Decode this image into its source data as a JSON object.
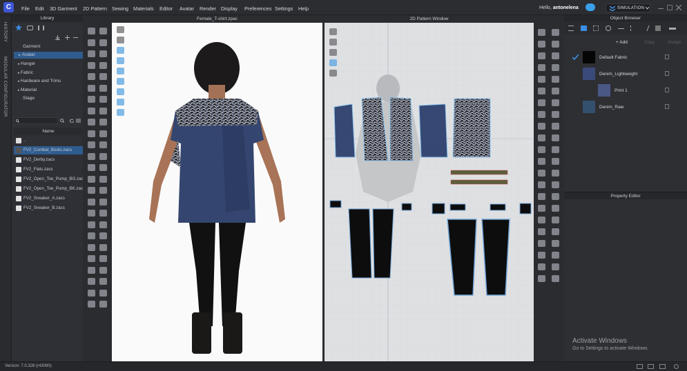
{
  "menu": [
    "File",
    "Edit",
    "3D Garment",
    "2D Pattern",
    "Sewing",
    "Materials",
    "Editor",
    "Avatar",
    "Render",
    "Display",
    "Preferences",
    "Settings",
    "Help"
  ],
  "user": {
    "greeting": "Hello,",
    "name": "antonelena"
  },
  "mode": "SIMULATION",
  "rail": {
    "history": "HISTORY",
    "modular": "MODULAR CONFIGURATOR"
  },
  "library": {
    "title": "Library",
    "tree": [
      "Garment",
      "Avatar",
      "Hanger",
      "Fabric",
      "Hardware and Trims",
      "Material",
      "Stage"
    ],
    "selected_tree": "Avatar",
    "column": "Name",
    "files": [
      "..",
      "FV2_Combat_Boots.zacs",
      "FV2_Derby.zacs",
      "FV2_Flats.zacs",
      "FV2_Open_Toe_Pump_BG.zacs",
      "FV2_Open_Toe_Pump_BK.zacs",
      "FV2_Sneaker_A.zacs",
      "FV2_Sneaker_B.zacs"
    ],
    "selected_file": "FV2_Combat_Boots.zacs"
  },
  "viewport3d": {
    "title": "Female_T-shirt.zpac"
  },
  "pattern": {
    "title": "2D Pattern Window"
  },
  "object_browser": {
    "title": "Object Browser",
    "add": "+ Add",
    "copy": "Copy",
    "assign": "Assign",
    "fabrics": [
      {
        "name": "Default Fabric",
        "color": "#050505",
        "checked": true
      },
      {
        "name": "Denim_Lightweight",
        "color": "#3a4a7a"
      },
      {
        "name": "Print 1",
        "color": "#4a5886",
        "child": true
      },
      {
        "name": "Denim_Raw",
        "color": "#34506f"
      }
    ]
  },
  "property_editor": {
    "title": "Property Editor"
  },
  "status": {
    "version": "Version: 7.0.328 (r43090)"
  },
  "watermark": {
    "line1": "Activate Windows",
    "line2": "Go to Settings to activate Windows."
  },
  "colors": {
    "accent": "#2f5c8f",
    "brand": "#3d56d6",
    "denim": "#34456f"
  }
}
